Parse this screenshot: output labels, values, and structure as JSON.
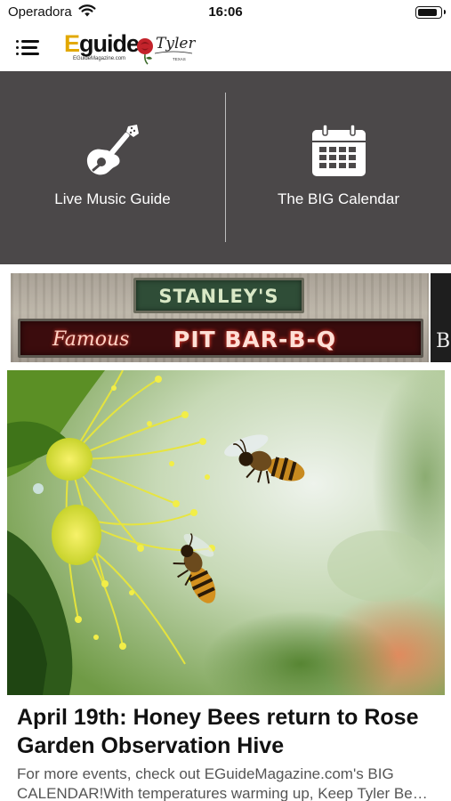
{
  "status_bar": {
    "carrier": "Operadora",
    "time": "16:06",
    "battery_level": 0.9,
    "icons": [
      "wifi-icon",
      "battery-icon"
    ]
  },
  "nav_bar": {
    "menu_icon": "hamburger-menu-icon",
    "logo_eguide": {
      "prefix": "E",
      "main": "guide",
      "subtitle": "EGuideMagazine.com"
    },
    "logo_tyler": {
      "text": "Tyler",
      "sub": "TEXAS",
      "icon": "rose-icon"
    }
  },
  "tiles": [
    {
      "label": "Live Music Guide",
      "icon": "guitar-icon"
    },
    {
      "label": "The BIG Calendar",
      "icon": "calendar-icon"
    }
  ],
  "ad_banner": {
    "top_sign": "STANLEY'S",
    "bottom_script": "Famous",
    "bottom_text": "PIT BAR-B-Q",
    "side_letter": "B"
  },
  "article": {
    "image": "honey-bees-flower-photo",
    "title": "April 19th: Honey Bees return to Rose Garden Observation Hive",
    "excerpt": "For more events, check out EGuideMagazine.com's BIG CALENDAR!With temperatures warming up, Keep Tyler Be…"
  },
  "colors": {
    "tile_background": "#4b4849",
    "logo_accent": "#e2a800",
    "excerpt_text": "#555555",
    "sign_green": "#2f4d37",
    "sign_red": "#3b0c0d"
  }
}
